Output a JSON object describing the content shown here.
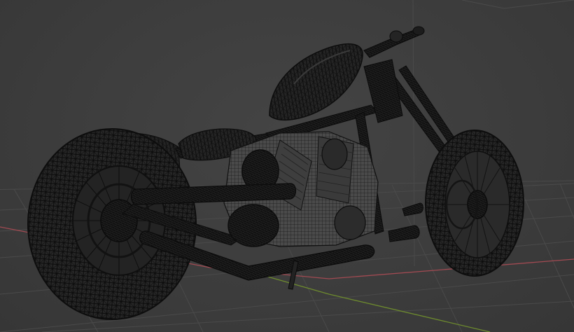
{
  "viewport": {
    "background_color": "#3d3d3d",
    "grid_line_color": "#4a4a4a",
    "x_axis_color": "#a24a52",
    "y_axis_color": "#6d8a2e",
    "wire_color": "#0d0d0d",
    "object_fill": "#1e1e1e",
    "object_fill_light": "#2b2b2b",
    "object_highlight": "#6a6a6a",
    "display_mode": "wireframe",
    "object": "motorcycle-chopper-model"
  }
}
